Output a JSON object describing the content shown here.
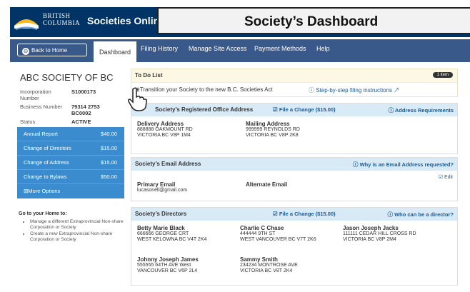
{
  "header": {
    "logo_line1": "BRITISH",
    "logo_line2": "COLUMBIA",
    "app_title": "Societies Online",
    "dashboard_title": "Society’s Dashboard"
  },
  "nav": {
    "back": "Back to Home",
    "tabs": [
      "Dashboard",
      "Filing History",
      "Manage Site Access",
      "Payment Methods",
      "Help"
    ]
  },
  "society": {
    "name": "ABC SOCIETY OF BC",
    "fields": [
      {
        "k": "Incorporation Number",
        "v": "S1000173"
      },
      {
        "k": "Business Number",
        "v": "79314 2753 BC0002"
      },
      {
        "k": "Status",
        "v": "ACTIVE"
      }
    ]
  },
  "menu": [
    {
      "label": "Annual Report",
      "price": "$40.00"
    },
    {
      "label": "Change of Directors",
      "price": "$15.00"
    },
    {
      "label": "Change of Address",
      "price": "$15.00"
    },
    {
      "label": "Change to Bylaws",
      "price": "$50.00"
    },
    {
      "label": "⊞More Options",
      "price": ""
    }
  ],
  "goto": {
    "title": "Go to your Home to:",
    "items": [
      "Manage a different Extraprovincial Non-share Corporation or Society",
      "Create a new Extraprovincial Non-share Corporation or Society"
    ]
  },
  "todo": {
    "title": "To Do List",
    "badge": "1 item",
    "item": "⊞Transition your Society to the new B.C. Societies Act",
    "link": "Step-by-step filing instructions"
  },
  "office": {
    "title": "Society’s Registered Office Address",
    "change": "File a Change ($15.00)",
    "req": "Address Requirements",
    "delivery": {
      "label": "Delivery Address",
      "l1": "888888 OAKMOUNT RD",
      "l2": "VICTORIA BC V8P 1M4"
    },
    "mailing": {
      "label": "Mailing Address",
      "l1": "999999 REYNOLDS RD",
      "l2": "VICTORIA BC V8P 2K8"
    }
  },
  "email": {
    "title": "Society’s Email Address",
    "why": "Why is an Email Address requested?",
    "edit": "Edit",
    "primary_label": "Primary Email",
    "primary": "lucasonell@gmail.com",
    "alt_label": "Alternate Email"
  },
  "directors": {
    "title": "Society’s Directors",
    "change": "File a Change ($15.00)",
    "who": "Who can be a director?",
    "list": [
      {
        "name": "Betty Marie Black",
        "l1": "666666 GEORGE CRT",
        "l2": "WEST KELOWNA BC V4T 2K4"
      },
      {
        "name": "Charlie C Chase",
        "l1": "444444 9TH ST",
        "l2": "WEST VANCOUVER BC V7T 2K6"
      },
      {
        "name": "Jason Joseph Jacks",
        "l1": "111111 CEDAR HILL CROSS RD",
        "l2": "VICTORIA BC V8P 2M4"
      },
      {
        "name": "Johnny Joseph James",
        "l1": "555555 64TH AVE West",
        "l2": "VANCOUVER BC V6P 2L4"
      },
      {
        "name": "Sammy Smith",
        "l1": "234234 MONTROSE AVE",
        "l2": "VICTORIA BC V8T 2K4"
      }
    ]
  },
  "colors": {
    "header": "#003366",
    "nav": "#38598a",
    "menu": "#3a8ccf",
    "section_header": "#d9eaf7",
    "todo_bg": "#fcf8e3"
  }
}
